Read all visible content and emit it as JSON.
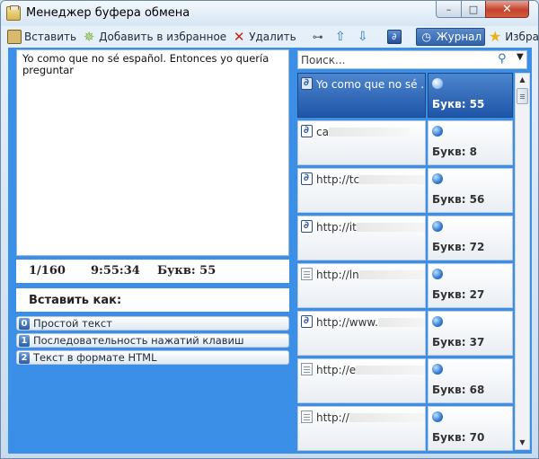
{
  "window": {
    "title": "Менеджер буфера обмена",
    "minimize_glyph": "–",
    "maximize_glyph": "□",
    "close_glyph": "✕"
  },
  "toolbar": {
    "paste_label": "Вставить",
    "add_favorite_label": "Добавить в избранное",
    "delete_label": "Удалить",
    "journal_label": "Журнал",
    "favorites_label": "Избранное"
  },
  "editor": {
    "text": "Yo como que no sé español. Entonces yo quería preguntar"
  },
  "status": {
    "position": "1/160",
    "time": "9:55:34",
    "chars": "Букв: 55"
  },
  "paste_as": {
    "title": "Вставить как:",
    "options": [
      {
        "num": "0",
        "label": "Простой текст"
      },
      {
        "num": "1",
        "label": "Последовательность нажатий клавиш"
      },
      {
        "num": "2",
        "label": "Текст в формате HTML"
      }
    ]
  },
  "search": {
    "placeholder": "Поиск..."
  },
  "history": [
    {
      "icon": "rich-text-icon",
      "text": "Yo como que no sé ...",
      "chars": "Букв: 55",
      "selected": true
    },
    {
      "icon": "rich-text-icon",
      "text": "ca",
      "chars": "Букв: 8"
    },
    {
      "icon": "rich-text-icon",
      "text": "http://tc",
      "chars": "Букв: 56"
    },
    {
      "icon": "rich-text-icon",
      "text": "http://it",
      "chars": "Букв: 72"
    },
    {
      "icon": "plain-text-icon",
      "text": "http://ln",
      "chars": "Букв: 27"
    },
    {
      "icon": "rich-text-icon",
      "text": "http://www.",
      "chars": "Букв: 37"
    },
    {
      "icon": "plain-text-icon",
      "text": "http://e",
      "chars": "Букв: 68"
    },
    {
      "icon": "plain-text-icon",
      "text": "http://",
      "chars": "Букв: 70"
    }
  ]
}
